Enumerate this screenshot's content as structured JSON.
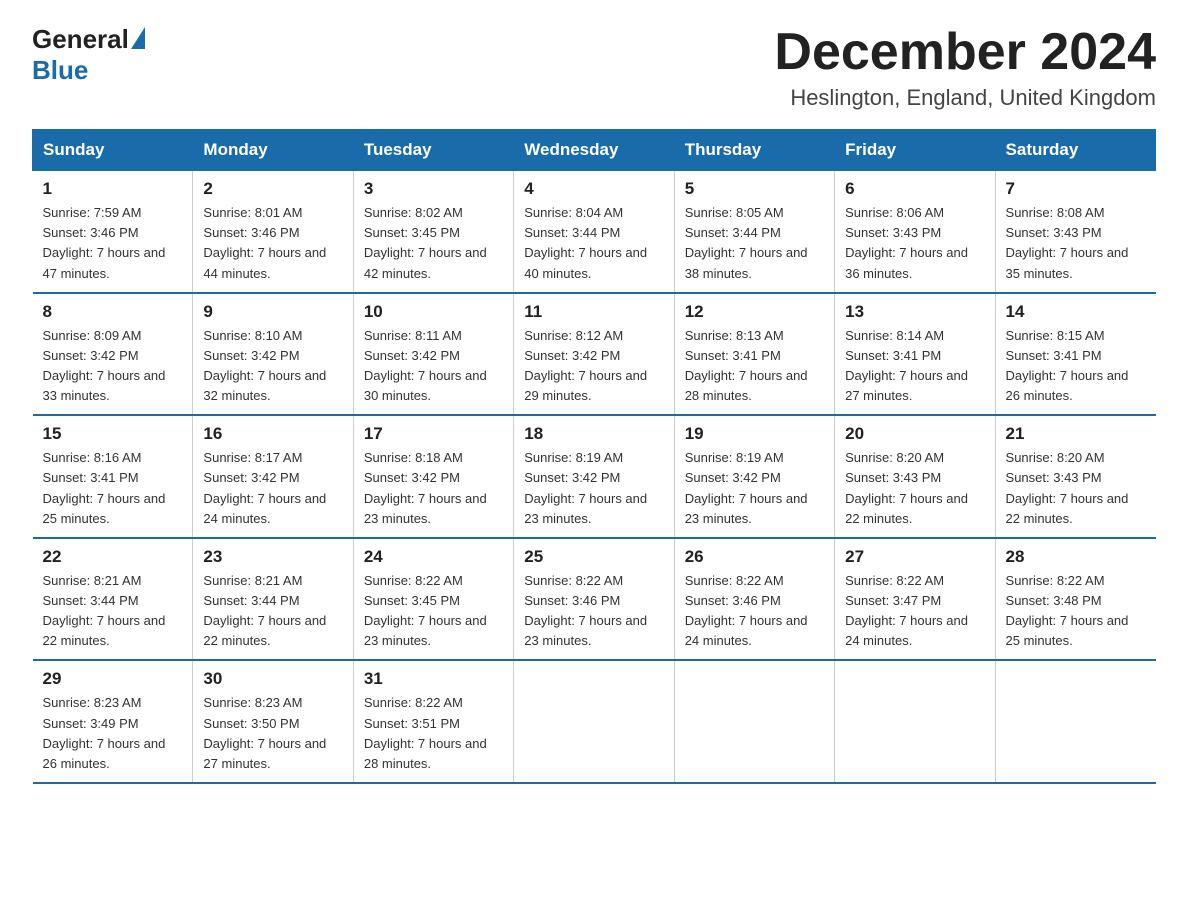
{
  "header": {
    "logo_general": "General",
    "logo_blue": "Blue",
    "month_title": "December 2024",
    "location": "Heslington, England, United Kingdom"
  },
  "weekdays": [
    "Sunday",
    "Monday",
    "Tuesday",
    "Wednesday",
    "Thursday",
    "Friday",
    "Saturday"
  ],
  "weeks": [
    [
      {
        "day": "1",
        "sunrise": "7:59 AM",
        "sunset": "3:46 PM",
        "daylight": "7 hours and 47 minutes."
      },
      {
        "day": "2",
        "sunrise": "8:01 AM",
        "sunset": "3:46 PM",
        "daylight": "7 hours and 44 minutes."
      },
      {
        "day": "3",
        "sunrise": "8:02 AM",
        "sunset": "3:45 PM",
        "daylight": "7 hours and 42 minutes."
      },
      {
        "day": "4",
        "sunrise": "8:04 AM",
        "sunset": "3:44 PM",
        "daylight": "7 hours and 40 minutes."
      },
      {
        "day": "5",
        "sunrise": "8:05 AM",
        "sunset": "3:44 PM",
        "daylight": "7 hours and 38 minutes."
      },
      {
        "day": "6",
        "sunrise": "8:06 AM",
        "sunset": "3:43 PM",
        "daylight": "7 hours and 36 minutes."
      },
      {
        "day": "7",
        "sunrise": "8:08 AM",
        "sunset": "3:43 PM",
        "daylight": "7 hours and 35 minutes."
      }
    ],
    [
      {
        "day": "8",
        "sunrise": "8:09 AM",
        "sunset": "3:42 PM",
        "daylight": "7 hours and 33 minutes."
      },
      {
        "day": "9",
        "sunrise": "8:10 AM",
        "sunset": "3:42 PM",
        "daylight": "7 hours and 32 minutes."
      },
      {
        "day": "10",
        "sunrise": "8:11 AM",
        "sunset": "3:42 PM",
        "daylight": "7 hours and 30 minutes."
      },
      {
        "day": "11",
        "sunrise": "8:12 AM",
        "sunset": "3:42 PM",
        "daylight": "7 hours and 29 minutes."
      },
      {
        "day": "12",
        "sunrise": "8:13 AM",
        "sunset": "3:41 PM",
        "daylight": "7 hours and 28 minutes."
      },
      {
        "day": "13",
        "sunrise": "8:14 AM",
        "sunset": "3:41 PM",
        "daylight": "7 hours and 27 minutes."
      },
      {
        "day": "14",
        "sunrise": "8:15 AM",
        "sunset": "3:41 PM",
        "daylight": "7 hours and 26 minutes."
      }
    ],
    [
      {
        "day": "15",
        "sunrise": "8:16 AM",
        "sunset": "3:41 PM",
        "daylight": "7 hours and 25 minutes."
      },
      {
        "day": "16",
        "sunrise": "8:17 AM",
        "sunset": "3:42 PM",
        "daylight": "7 hours and 24 minutes."
      },
      {
        "day": "17",
        "sunrise": "8:18 AM",
        "sunset": "3:42 PM",
        "daylight": "7 hours and 23 minutes."
      },
      {
        "day": "18",
        "sunrise": "8:19 AM",
        "sunset": "3:42 PM",
        "daylight": "7 hours and 23 minutes."
      },
      {
        "day": "19",
        "sunrise": "8:19 AM",
        "sunset": "3:42 PM",
        "daylight": "7 hours and 23 minutes."
      },
      {
        "day": "20",
        "sunrise": "8:20 AM",
        "sunset": "3:43 PM",
        "daylight": "7 hours and 22 minutes."
      },
      {
        "day": "21",
        "sunrise": "8:20 AM",
        "sunset": "3:43 PM",
        "daylight": "7 hours and 22 minutes."
      }
    ],
    [
      {
        "day": "22",
        "sunrise": "8:21 AM",
        "sunset": "3:44 PM",
        "daylight": "7 hours and 22 minutes."
      },
      {
        "day": "23",
        "sunrise": "8:21 AM",
        "sunset": "3:44 PM",
        "daylight": "7 hours and 22 minutes."
      },
      {
        "day": "24",
        "sunrise": "8:22 AM",
        "sunset": "3:45 PM",
        "daylight": "7 hours and 23 minutes."
      },
      {
        "day": "25",
        "sunrise": "8:22 AM",
        "sunset": "3:46 PM",
        "daylight": "7 hours and 23 minutes."
      },
      {
        "day": "26",
        "sunrise": "8:22 AM",
        "sunset": "3:46 PM",
        "daylight": "7 hours and 24 minutes."
      },
      {
        "day": "27",
        "sunrise": "8:22 AM",
        "sunset": "3:47 PM",
        "daylight": "7 hours and 24 minutes."
      },
      {
        "day": "28",
        "sunrise": "8:22 AM",
        "sunset": "3:48 PM",
        "daylight": "7 hours and 25 minutes."
      }
    ],
    [
      {
        "day": "29",
        "sunrise": "8:23 AM",
        "sunset": "3:49 PM",
        "daylight": "7 hours and 26 minutes."
      },
      {
        "day": "30",
        "sunrise": "8:23 AM",
        "sunset": "3:50 PM",
        "daylight": "7 hours and 27 minutes."
      },
      {
        "day": "31",
        "sunrise": "8:22 AM",
        "sunset": "3:51 PM",
        "daylight": "7 hours and 28 minutes."
      },
      null,
      null,
      null,
      null
    ]
  ]
}
